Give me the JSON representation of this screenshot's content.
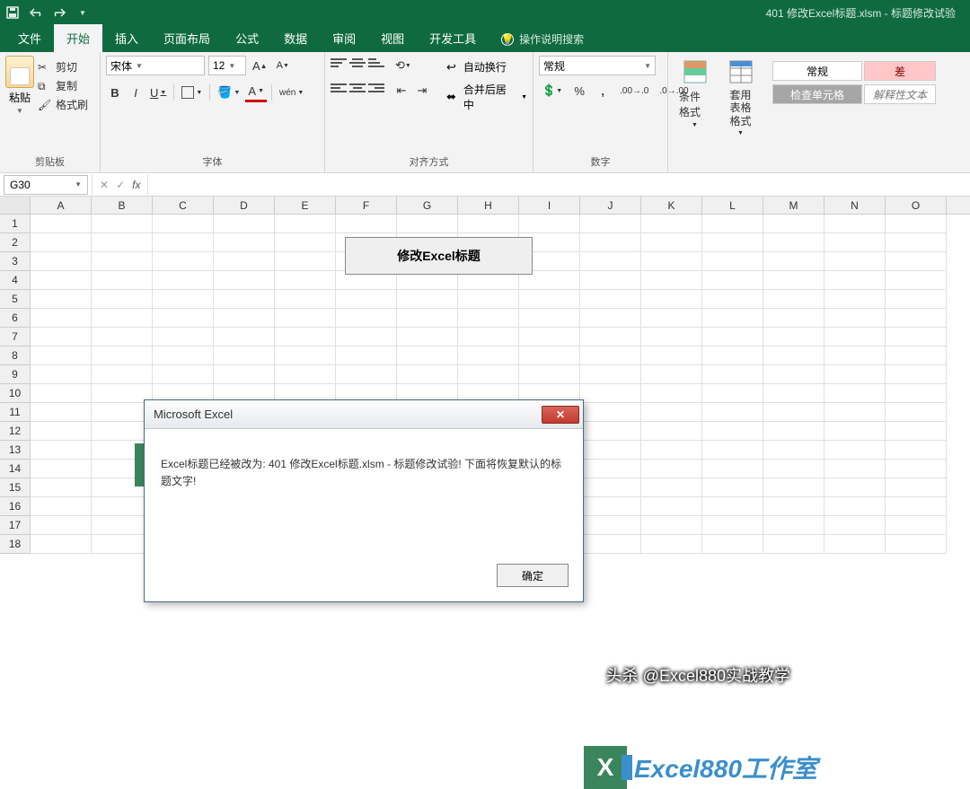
{
  "title": "401 修改Excel标题.xlsm - 标题修改试验",
  "tabs": {
    "file": "文件",
    "home": "开始",
    "insert": "插入",
    "layout": "页面布局",
    "formulas": "公式",
    "data": "数据",
    "review": "审阅",
    "view": "视图",
    "dev": "开发工具",
    "tell": "操作说明搜索"
  },
  "clipboard": {
    "paste": "粘贴",
    "cut": "剪切",
    "copy": "复制",
    "painter": "格式刷",
    "group": "剪贴板"
  },
  "font": {
    "name": "宋体",
    "size": "12",
    "group": "字体",
    "wen": "wén"
  },
  "align": {
    "wrap": "自动换行",
    "merge": "合并后居中",
    "group": "对齐方式"
  },
  "number": {
    "format": "常规",
    "group": "数字"
  },
  "styles_btns": {
    "cond": "条件格式",
    "table": "套用\n表格格式"
  },
  "style_cells": {
    "normal": "常规",
    "bad": "差",
    "check": "检查单元格",
    "explain": "解释性文本"
  },
  "namebox": "G30",
  "columns": [
    "A",
    "B",
    "C",
    "D",
    "E",
    "F",
    "G",
    "H",
    "I",
    "J",
    "K",
    "L",
    "M",
    "N",
    "O"
  ],
  "row_count": 18,
  "sheet_button": "修改Excel标题",
  "watermark": "Excel880工作室",
  "watermark_badge": "X",
  "dialog": {
    "title": "Microsoft Excel",
    "body": "Excel标题已经被改为: 401 修改Excel标题.xlsm - 标题修改试验! 下面将恢复默认的标题文字!",
    "ok": "确定"
  },
  "footer_wm": "头杀 @Excel880实战教学"
}
